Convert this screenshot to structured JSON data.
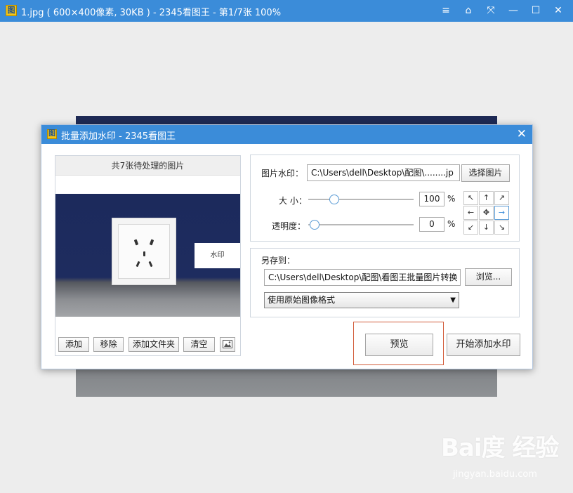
{
  "window": {
    "title": "1.jpg ( 600×400像素, 30KB ) - 2345看图王 - 第1/7张 100%",
    "controls": [
      "≡",
      "⌂",
      "⤧",
      "—",
      "☐",
      "✕"
    ]
  },
  "dialog": {
    "title": "批量添加水印 - 2345看图王",
    "close_glyph": "✕",
    "left": {
      "header": "共7张待处理的图片",
      "watermark_text": "水印",
      "buttons": [
        "添加",
        "移除",
        "添加文件夹",
        "清空"
      ],
      "image_button_icon": "image-icon"
    },
    "watermark_group": {
      "label": "图片水印：",
      "path": "C:\\Users\\dell\\Desktop\\配图\\........jp",
      "select_button": "选择图片",
      "size_label": "大 小：",
      "size_value": "100",
      "size_level_fraction": 0.2,
      "opacity_label": "透明度：",
      "opacity_value": "0",
      "opacity_level_fraction": 0.0,
      "percent": "%",
      "position_grid": [
        "↖",
        "↑",
        "↗",
        "←",
        "✥",
        "→",
        "↙",
        "↓",
        "↘"
      ],
      "selected_position_index": 5
    },
    "save_group": {
      "label": "另存到：",
      "path": "C:\\Users\\dell\\Desktop\\配图\\看图王批量图片转换",
      "browse_button": "浏览...",
      "format_option": "使用原始图像格式"
    },
    "preview_button": "预览",
    "start_button": "开始添加水印"
  },
  "watermark_logo": {
    "main": "Bai度 经验",
    "sub": "jingyan.baidu.com"
  },
  "colors": {
    "title_bar": "#3b8cd9",
    "highlight": "#d25c3a"
  }
}
